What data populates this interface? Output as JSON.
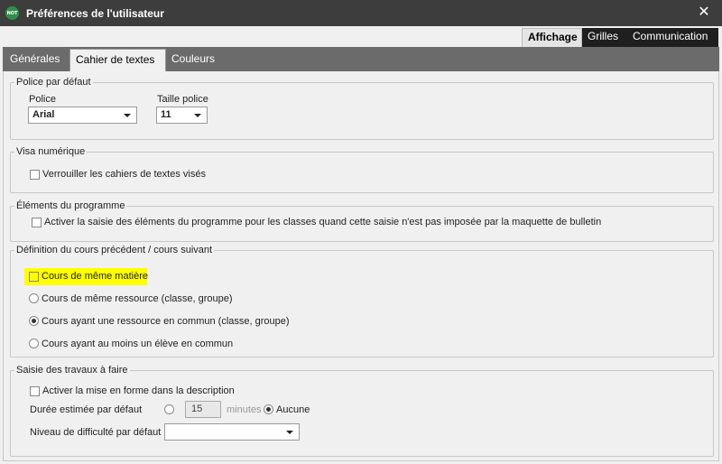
{
  "window": {
    "icon_text": "NOT",
    "title": "Préférences de l'utilisateur"
  },
  "top_tabs": [
    {
      "label": "Affichage",
      "active": true
    },
    {
      "label": "Grilles",
      "active": false
    },
    {
      "label": "Communication",
      "active": false
    }
  ],
  "sub_tabs": [
    {
      "label": "Générales",
      "active": false
    },
    {
      "label": "Cahier de textes",
      "active": true
    },
    {
      "label": "Couleurs",
      "active": false
    }
  ],
  "police": {
    "legend": "Police par défaut",
    "font_label": "Police",
    "font_value": "Arial",
    "size_label": "Taille police",
    "size_value": "11"
  },
  "visa": {
    "legend": "Visa numérique",
    "checkbox_label": "Verrouiller les cahiers de textes visés",
    "checked": false
  },
  "programme": {
    "legend": "Éléments du programme",
    "checkbox_label": "Activer la saisie des éléments du programme pour les classes quand cette saisie n'est pas imposée par la maquette de bulletin",
    "checked": false
  },
  "definition": {
    "legend": "Définition du cours précédent / cours suivant",
    "checkbox_label": "Cours de même matière",
    "options": [
      {
        "label": "Cours de même ressource (classe, groupe)",
        "selected": false
      },
      {
        "label": "Cours ayant une ressource en commun (classe, groupe)",
        "selected": true
      },
      {
        "label": "Cours ayant au moins un élève en commun",
        "selected": false
      }
    ]
  },
  "travaux": {
    "legend": "Saisie des travaux à faire",
    "format_label": "Activer la mise en forme dans la description",
    "duration_label": "Durée estimée par défaut",
    "duration_value": "15",
    "minutes_label": "minutes",
    "none_label": "Aucune",
    "difficulty_label": "Niveau de difficulté par défaut",
    "difficulty_value": ""
  },
  "colors": {
    "titlebar": "#3d3d3d",
    "subtab_bar": "#6b6b6b",
    "highlight": "#ffff00",
    "app_icon": "#2f8f4a"
  }
}
